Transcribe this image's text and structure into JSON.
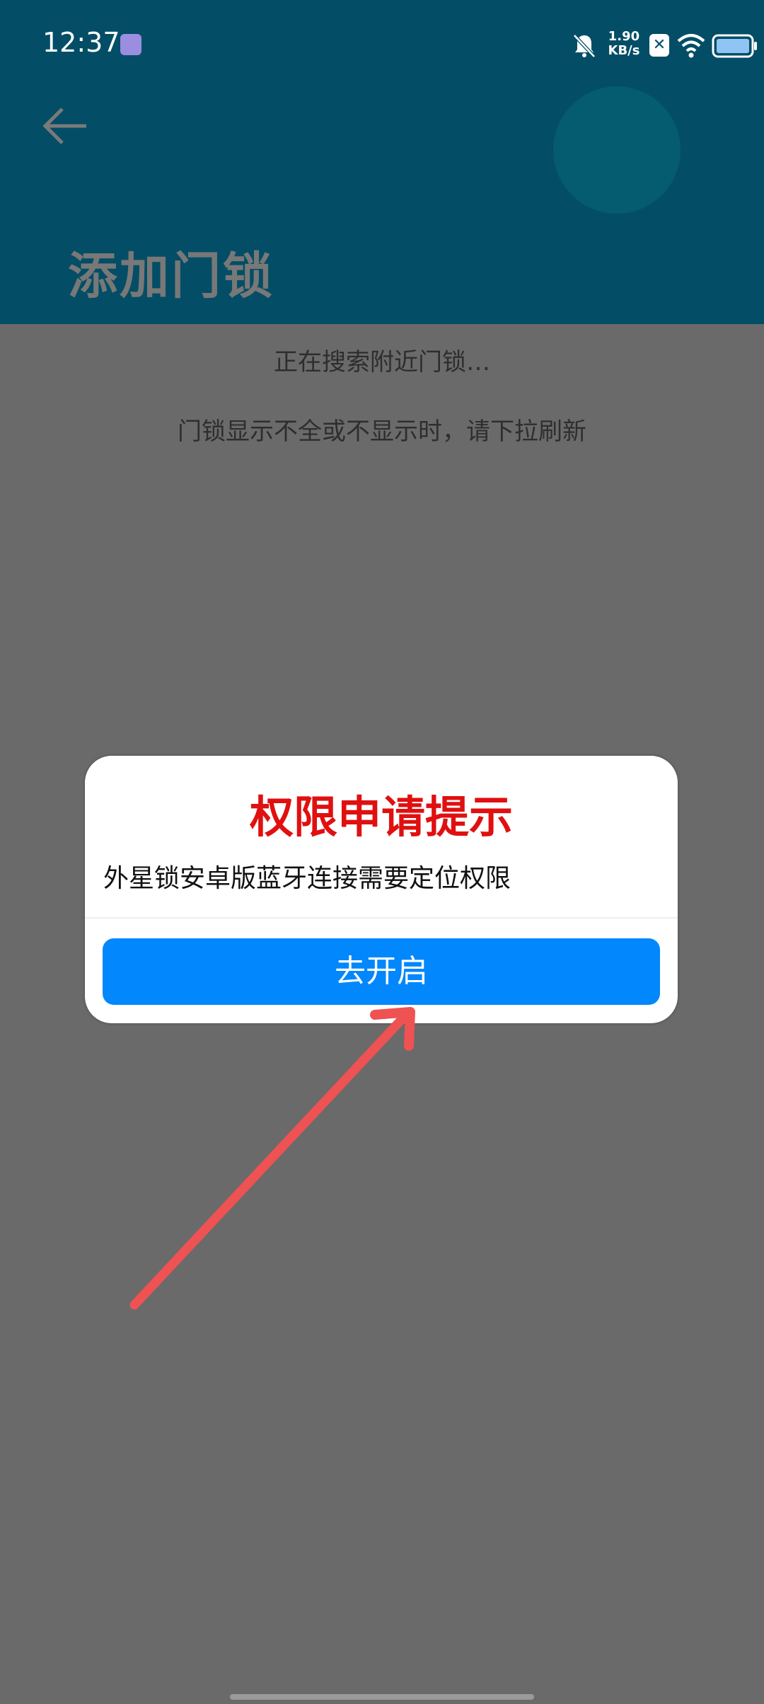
{
  "status_bar": {
    "time": "12:37",
    "net_speed_value": "1.90",
    "net_speed_unit": "KB/s",
    "icons": [
      "app-notification-icon",
      "bell-muted-icon",
      "close-box-icon",
      "wifi-icon",
      "battery-icon"
    ]
  },
  "header": {
    "title": "添加门锁",
    "background_color": "#034e66"
  },
  "content": {
    "search_status": "正在搜索附近门锁…",
    "refresh_tip": "门锁显示不全或不显示时，请下拉刷新"
  },
  "dialog": {
    "title": "权限申请提示",
    "message": "外星锁安卓版蓝牙连接需要定位权限",
    "button_label": "去开启",
    "title_color": "#e01010",
    "button_color": "#0287fd"
  },
  "annotation": {
    "arrow_color": "#ee5252",
    "icon": "red-arrow-pointing-to-button"
  }
}
